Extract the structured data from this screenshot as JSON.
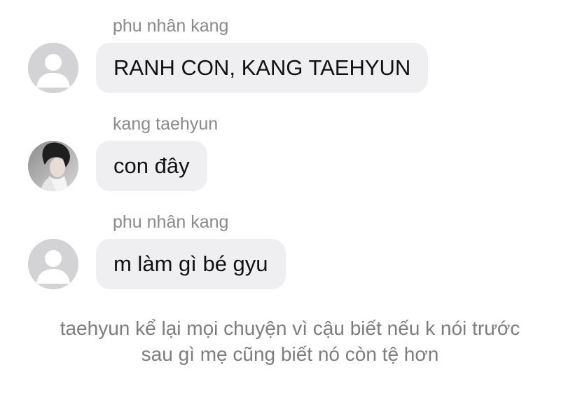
{
  "messages": [
    {
      "sender": "phu nhân kang",
      "text": "RANH CON, KANG TAEHYUN",
      "avatar": "default-user-icon"
    },
    {
      "sender": "kang taehyun",
      "text": "con đây",
      "avatar": "profile-photo"
    },
    {
      "sender": "phu nhân kang",
      "text": "m làm gì bé gyu",
      "avatar": "default-user-icon"
    }
  ],
  "narration": "taehyun kể lại mọi chuyện vì cậu biết nếu k nói trước sau gì mẹ cũng biết nó còn tệ hơn",
  "colors": {
    "bubble": "#efeff1",
    "sender": "#8a8a8e",
    "narration": "#7d7d7d",
    "default_avatar": "#d3d3d6"
  }
}
